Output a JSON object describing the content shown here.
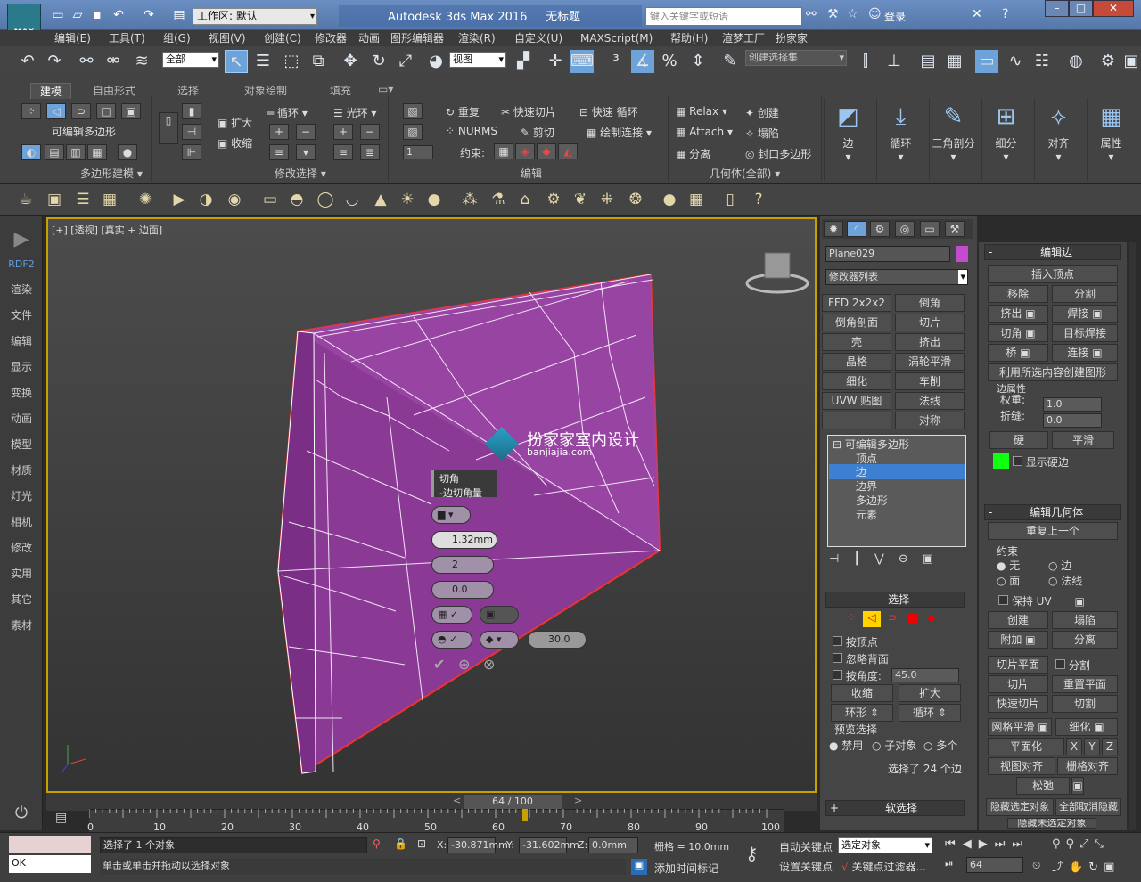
{
  "titlebar": {
    "logo": "MAX",
    "workspace": "工作区: 默认",
    "title": "Autodesk 3ds Max 2016",
    "doc": "无标题",
    "search_placeholder": "键入关键字或短语",
    "login": "登录"
  },
  "menu": [
    "编辑(E)",
    "工具(T)",
    "组(G)",
    "视图(V)",
    "创建(C)",
    "修改器",
    "动画",
    "图形编辑器",
    "渲染(R)",
    "自定义(U)",
    "MAXScript(M)",
    "帮助(H)",
    "渲梦工厂",
    "扮家家"
  ],
  "toolbar": {
    "filter": "全部",
    "refcoord": "视图",
    "selset": "创建选择集"
  },
  "ribbon": {
    "tabs": [
      "建模",
      "自由形式",
      "选择",
      "对象绘制",
      "填充"
    ],
    "poly_label": "可编辑多边形",
    "group_polymodeling": "多边形建模",
    "expand": "扩大",
    "shrink": "收缩",
    "loop": "循环",
    "ring": "光环",
    "group_modsel": "修改选择",
    "repeat": "重复",
    "quickslice": "快速切片",
    "quickloop": "快速 循环",
    "nurms": "NURMS",
    "cut": "剪切",
    "paintconnect": "绘制连接",
    "constraint": "约束:",
    "spin_val": "1",
    "group_edit": "编辑",
    "relax": "Relax",
    "create": "创建",
    "attach": "Attach",
    "collapse": "塌陷",
    "detach": "分离",
    "cap": "封口多边形",
    "group_geo": "几何体(全部)",
    "big": [
      "边",
      "循环",
      "三角剖分",
      "细分",
      "对齐",
      "属性"
    ]
  },
  "sidebar": [
    "RDF2",
    "渲染",
    "文件",
    "编辑",
    "显示",
    "变换",
    "动画",
    "模型",
    "材质",
    "灯光",
    "相机",
    "修改",
    "实用",
    "其它",
    "素材"
  ],
  "viewport": {
    "label": "[+] [透视] [真实 + 边面]",
    "watermark": "扮家家室内设计",
    "watermark_url": "banjiajia.com",
    "caddy_title": "切角",
    "caddy_sub": "-边切角量",
    "amount": "1.32mm",
    "segs": "2",
    "tension": "0.0",
    "threshold": "30.0"
  },
  "command": {
    "object_name": "Plane029",
    "modlist": "修改器列表",
    "mods": [
      "FFD 2x2x2",
      "倒角",
      "倒角剖面",
      "切片",
      "壳",
      "挤出",
      "晶格",
      "涡轮平滑",
      "细化",
      "车削",
      "UVW 贴图",
      "法线",
      "",
      "对称"
    ],
    "stack": [
      "可编辑多边形",
      "顶点",
      "边",
      "边界",
      "多边形",
      "元素"
    ],
    "sel_hdr": "选择",
    "by_vertex": "按顶点",
    "ignore_back": "忽略背面",
    "by_angle": "按角度:",
    "angle_val": "45.0",
    "shrink": "收缩",
    "grow": "扩大",
    "ring": "环形",
    "loop": "循环",
    "preview": "预览选择",
    "off": "禁用",
    "subobj": "子对象",
    "multi": "多个",
    "selected": "选择了 24 个边",
    "soft": "软选择"
  },
  "edit_edges": {
    "hdr": "编辑边",
    "insert": "插入顶点",
    "remove": "移除",
    "split": "分割",
    "extrude": "挤出",
    "weld": "焊接",
    "chamfer": "切角",
    "target_weld": "目标焊接",
    "bridge": "桥",
    "connect": "连接",
    "create_shape": "利用所选内容创建图形",
    "edge_props": "边属性",
    "weight": "权重:",
    "weight_val": "1.0",
    "crease": "折缝:",
    "crease_val": "0.0",
    "hard": "硬",
    "smooth": "平滑",
    "show_hard": "显示硬边"
  },
  "edit_geo": {
    "hdr": "编辑几何体",
    "repeat": "重复上一个",
    "constraint": "约束",
    "none": "无",
    "edge": "边",
    "face": "面",
    "normal": "法线",
    "preserve_uv": "保持 UV",
    "create": "创建",
    "collapse": "塌陷",
    "attach": "附加",
    "detach": "分离",
    "slice_plane": "切片平面",
    "split": "分割",
    "slice": "切片",
    "reset_plane": "重置平面",
    "quickslice": "快速切片",
    "cut": "切割",
    "meshsmooth": "网格平滑",
    "tessellate": "细化",
    "planarize": "平面化",
    "x": "X",
    "y": "Y",
    "z": "Z",
    "view_align": "视图对齐",
    "grid_align": "栅格对齐",
    "relax": "松弛",
    "hide_sel": "隐藏选定对象",
    "unhide": "全部取消隐藏",
    "hide_unsel": "隐藏未选定对象"
  },
  "timeline": {
    "frame": "64 / 100",
    "ticks": [
      "0",
      "10",
      "20",
      "30",
      "40",
      "50",
      "60",
      "70",
      "80",
      "90",
      "100"
    ]
  },
  "status": {
    "selinfo": "选择了 1 个对象",
    "prompt": "单击或单击并拖动以选择对象",
    "ok": "OK",
    "x": "-30.871mm",
    "y": "-31.602mm",
    "z": "0.0mm",
    "grid": "栅格 = 10.0mm",
    "autokey": "自动关键点",
    "setkey": "设置关键点",
    "selobj": "选定对象",
    "keyfilter": "关键点过滤器...",
    "addtime": "添加时间标记",
    "frame": "64"
  }
}
